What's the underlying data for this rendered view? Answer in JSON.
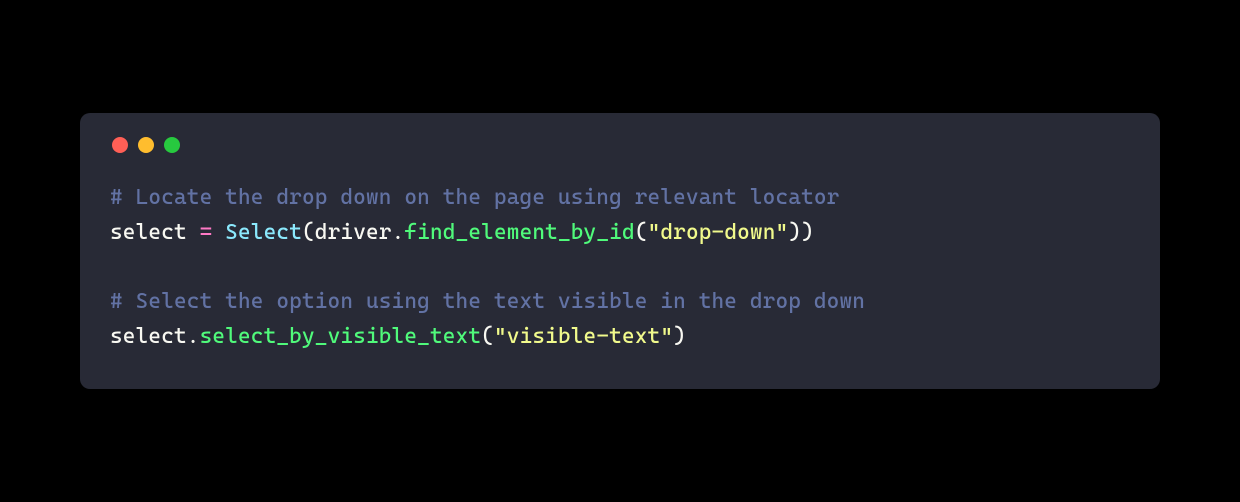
{
  "colors": {
    "background_page": "#000000",
    "background_window": "#282a36",
    "comment": "#6272a4",
    "plain": "#f8f8f2",
    "keyword": "#ff79c6",
    "class": "#8be9fd",
    "function": "#50fa7b",
    "string": "#f1fa8c",
    "dot_red": "#ff5f56",
    "dot_yellow": "#ffbd2e",
    "dot_green": "#27c93f"
  },
  "code": {
    "line1": {
      "comment": "# Locate the drop down on the page using relevant locator"
    },
    "line2": {
      "var": "select ",
      "assign": "= ",
      "class": "Select",
      "open": "(driver.",
      "method": "find_element_by_id",
      "argopen": "(",
      "string": "\"drop-down\"",
      "close": "))"
    },
    "line3": {
      "blank": ""
    },
    "line4": {
      "comment": "# Select the option using the text visible in the drop down"
    },
    "line5": {
      "obj": "select.",
      "method": "select_by_visible_text",
      "argopen": "(",
      "string": "\"visible-text\"",
      "close": ")"
    }
  }
}
